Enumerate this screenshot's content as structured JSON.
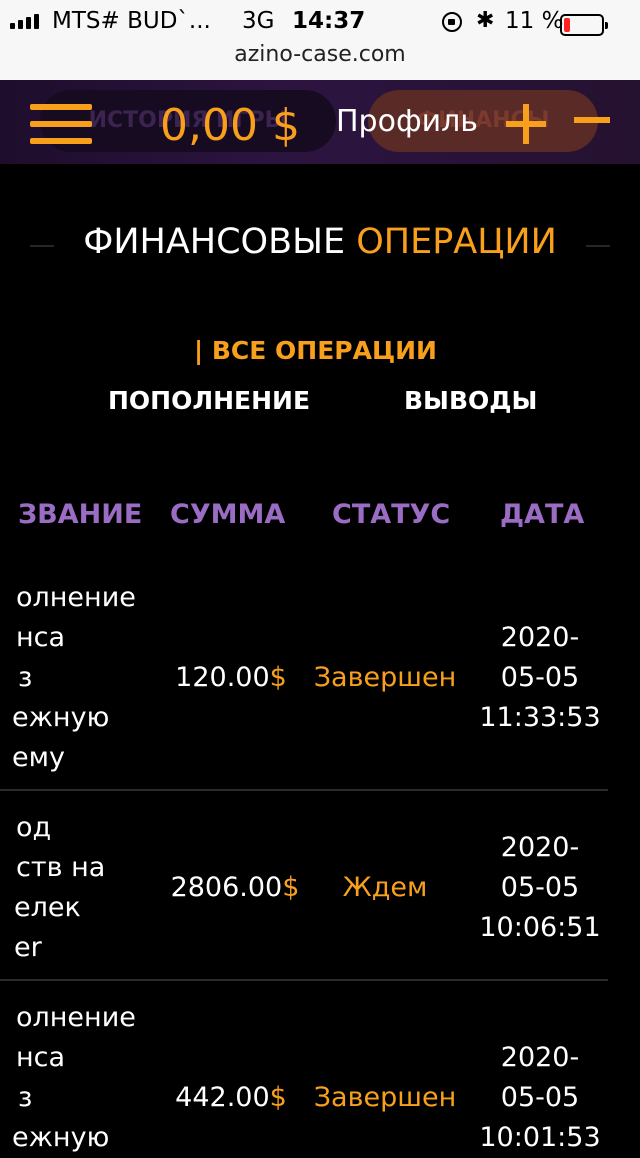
{
  "status_bar": {
    "carrier": "MTS# BUD`...",
    "network": "3G",
    "time": "14:37",
    "battery": "11 %",
    "url": "azino-case.com"
  },
  "header": {
    "ghost_history": "ИСТОРИЯ ИГРЫ",
    "ghost_finance": "ФИНАНСЫ",
    "balance": "0,00 $",
    "profile": "Профиль",
    "accent": "#f8a01c"
  },
  "title": {
    "part1": "ФИНАНСОВЫЕ",
    "part2": "ОПЕРАЦИИ"
  },
  "filters": {
    "all": "| ВСЕ ОПЕРАЦИИ",
    "deposit": "ПОПОЛНЕНИЕ",
    "withdrawals": "ВЫВОДЫ"
  },
  "table": {
    "headers": [
      "ЗВАНИЕ",
      "СУММА",
      "СТАТУС",
      "ДАТА"
    ],
    "rows": [
      {
        "desc": [
          "олнение",
          "нса",
          "з",
          "ежную",
          "ему"
        ],
        "amount": "120.00",
        "currency": "$",
        "status": "Завершен",
        "date": [
          "2020-",
          "05-05",
          "11:33:53"
        ]
      },
      {
        "desc": [
          "од",
          "ств на",
          "елек",
          "er"
        ],
        "amount": "2806.00",
        "currency": "$",
        "status": "Ждем",
        "date": [
          "2020-",
          "05-05",
          "10:06:51"
        ]
      },
      {
        "desc": [
          "олнение",
          "нса",
          "з",
          "ежную"
        ],
        "amount": "442.00",
        "currency": "$",
        "status": "Завершен",
        "date": [
          "2020-",
          "05-05",
          "10:01:53"
        ]
      }
    ]
  }
}
